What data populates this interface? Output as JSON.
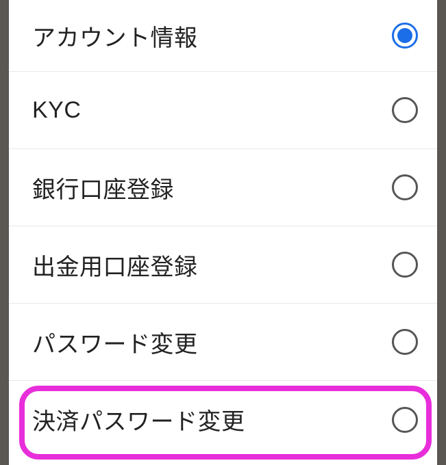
{
  "menu": {
    "items": [
      {
        "id": "account-info",
        "label": "アカウント情報",
        "selected": true
      },
      {
        "id": "kyc",
        "label": "KYC",
        "selected": false
      },
      {
        "id": "bank-account-register",
        "label": "銀行口座登録",
        "selected": false
      },
      {
        "id": "withdrawal-account-register",
        "label": "出金用口座登録",
        "selected": false
      },
      {
        "id": "password-change",
        "label": "パスワード変更",
        "selected": false
      },
      {
        "id": "payment-password-change",
        "label": "決済パスワード変更",
        "selected": false
      }
    ]
  },
  "highlight": {
    "target": "payment-password-change",
    "color": "#e82eda"
  }
}
